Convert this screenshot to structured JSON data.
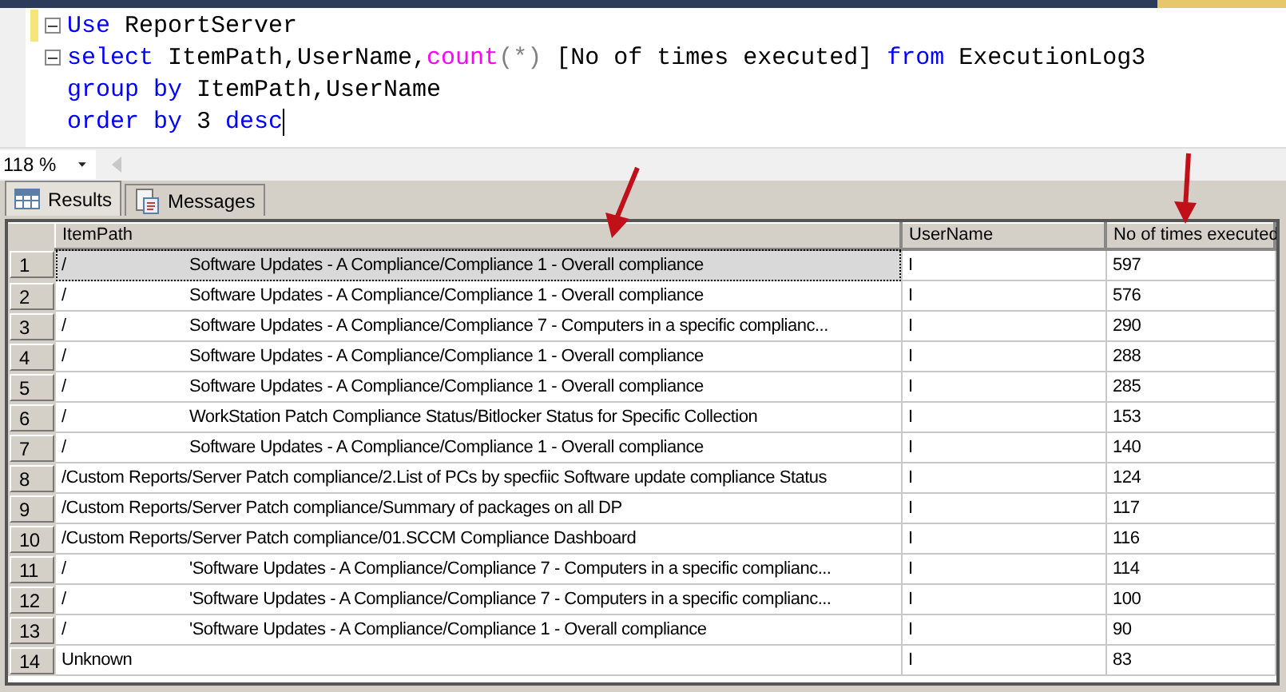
{
  "editor": {
    "lines": [
      {
        "fold": true,
        "changed": true,
        "cursor": false,
        "tokens": [
          {
            "kind": "keyword",
            "text": "Use"
          },
          {
            "kind": "plain",
            "text": " ReportServer"
          }
        ]
      },
      {
        "fold": true,
        "changed": false,
        "cursor": false,
        "tokens": [
          {
            "kind": "keyword",
            "text": "select"
          },
          {
            "kind": "plain",
            "text": " ItemPath,UserName,"
          },
          {
            "kind": "function",
            "text": "count"
          },
          {
            "kind": "operator",
            "text": "(*)"
          },
          {
            "kind": "plain",
            "text": " [No of times executed] "
          },
          {
            "kind": "keyword",
            "text": "from"
          },
          {
            "kind": "plain",
            "text": " ExecutionLog3"
          }
        ]
      },
      {
        "fold": false,
        "changed": false,
        "cursor": false,
        "tokens": [
          {
            "kind": "keyword",
            "text": "group by"
          },
          {
            "kind": "plain",
            "text": " ItemPath,UserName"
          }
        ]
      },
      {
        "fold": false,
        "changed": false,
        "cursor": true,
        "tokens": [
          {
            "kind": "keyword",
            "text": "order by"
          },
          {
            "kind": "plain",
            "text": " 3 "
          },
          {
            "kind": "keyword",
            "text": "desc"
          }
        ]
      }
    ]
  },
  "zoom": {
    "value": "118 %"
  },
  "tabs": [
    {
      "label": "Results",
      "selected": true
    },
    {
      "label": "Messages",
      "selected": false
    }
  ],
  "table": {
    "columns": [
      "ItemPath",
      "UserName",
      "No of times executed"
    ],
    "rows": [
      {
        "number": "1",
        "path_start": "/",
        "path_end": "Software Updates - A Compliance/Compliance 1 - Overall compliance",
        "user": "I",
        "count": "597",
        "selected": true
      },
      {
        "number": "2",
        "path_start": "/",
        "path_end": "Software Updates - A Compliance/Compliance 1 - Overall compliance",
        "user": "I",
        "count": "576",
        "selected": false
      },
      {
        "number": "3",
        "path_start": "/",
        "path_end": "Software Updates - A Compliance/Compliance 7 - Computers in a specific complianc...",
        "user": "I",
        "count": "290",
        "selected": false
      },
      {
        "number": "4",
        "path_start": "/",
        "path_end": "Software Updates - A Compliance/Compliance 1 - Overall compliance",
        "user": "I",
        "count": "288",
        "selected": false
      },
      {
        "number": "5",
        "path_start": "/",
        "path_end": "Software Updates - A Compliance/Compliance 1 - Overall compliance",
        "user": "I",
        "count": "285",
        "selected": false
      },
      {
        "number": "6",
        "path_start": "/",
        "path_end": "WorkStation Patch Compliance Status/Bitlocker Status for Specific Collection",
        "user": "I",
        "count": "153",
        "selected": false
      },
      {
        "number": "7",
        "path_start": "/",
        "path_end": "Software Updates - A Compliance/Compliance 1 - Overall compliance",
        "user": "I",
        "count": "140",
        "selected": false
      },
      {
        "number": "8",
        "item_path": "/Custom Reports/Server Patch compliance/2.List of PCs by specfiic Software update compliance Status",
        "user": "I",
        "count": "124",
        "selected": false
      },
      {
        "number": "9",
        "item_path": "/Custom Reports/Server Patch compliance/Summary of packages on all DP",
        "user": "I",
        "count": "117",
        "selected": false
      },
      {
        "number": "10",
        "item_path": "/Custom Reports/Server Patch compliance/01.SCCM Compliance Dashboard",
        "user": "I",
        "count": "116",
        "selected": false
      },
      {
        "number": "11",
        "path_start": "/",
        "path_end": "'Software Updates - A Compliance/Compliance 7 - Computers in a specific complianc...",
        "user": "I",
        "count": "114",
        "selected": false
      },
      {
        "number": "12",
        "path_start": "/",
        "path_end": "'Software Updates - A Compliance/Compliance 7 - Computers in a specific complianc...",
        "user": "I",
        "count": "100",
        "selected": false
      },
      {
        "number": "13",
        "path_start": "/",
        "path_end": "'Software Updates - A Compliance/Compliance 1 - Overall compliance",
        "user": "I",
        "count": "90",
        "selected": false
      },
      {
        "number": "14",
        "item_path": "Unknown",
        "user": "I",
        "count": "83",
        "selected": false
      }
    ]
  }
}
